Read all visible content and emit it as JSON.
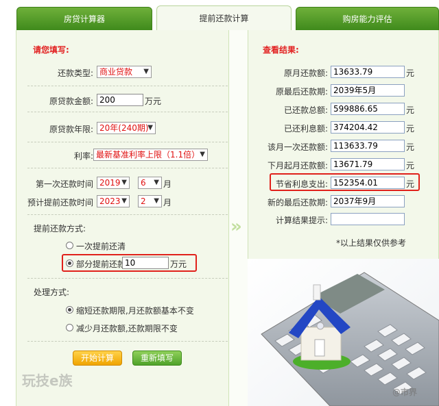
{
  "tabs": [
    "房贷计算器",
    "提前还款计算",
    "购房能力评估"
  ],
  "left": {
    "heading": "请您填写:",
    "repay_type_label": "还款类型:",
    "repay_type_value": "商业贷款",
    "loan_amount_label": "原贷款金额:",
    "loan_amount_value": "200",
    "loan_amount_unit": "万元",
    "term_label": "原贷款年限:",
    "term_value": "20年(240期)",
    "rate_label": "利率:",
    "rate_value": "最新基准利率上限（1.1倍）",
    "first_repay_label": "第一次还款时间",
    "first_repay_year": "2019",
    "first_repay_month": "6",
    "prepay_time_label": "预计提前还款时间",
    "prepay_year": "2023",
    "prepay_month": "2",
    "month_unit": "月",
    "method_label": "提前还款方式:",
    "option_full": "一次提前还清",
    "option_partial": "部分提前还款",
    "partial_value": "10",
    "partial_unit": "万元",
    "process_label": "处理方式:",
    "process_shorten": "缩短还款期限,月还款额基本不变",
    "process_reduce": "减少月还款额,还款期限不变",
    "btn_calc": "开始计算",
    "btn_reset": "重新填写"
  },
  "right": {
    "heading": "查看结果:",
    "yuan": "元",
    "rows": [
      {
        "label": "原月还款额:",
        "value": "13633.79",
        "unit": "元"
      },
      {
        "label": "原最后还款期:",
        "value": "2039年5月",
        "unit": ""
      },
      {
        "label": "已还款总额:",
        "value": "599886.65",
        "unit": "元"
      },
      {
        "label": "已还利息额:",
        "value": "374204.42",
        "unit": "元"
      },
      {
        "label": "该月一次还款额:",
        "value": "113633.79",
        "unit": "元"
      },
      {
        "label": "下月起月还款额:",
        "value": "13671.79",
        "unit": "元"
      },
      {
        "label": "节省利息支出:",
        "value": "152354.01",
        "unit": "元"
      },
      {
        "label": "新的最后还款期:",
        "value": "2037年9月",
        "unit": ""
      },
      {
        "label": "计算结果提示:",
        "value": "",
        "unit": ""
      }
    ],
    "note": "*以上结果仅供参考"
  },
  "watermark_left": "玩技e族",
  "watermark_right": "@市界"
}
